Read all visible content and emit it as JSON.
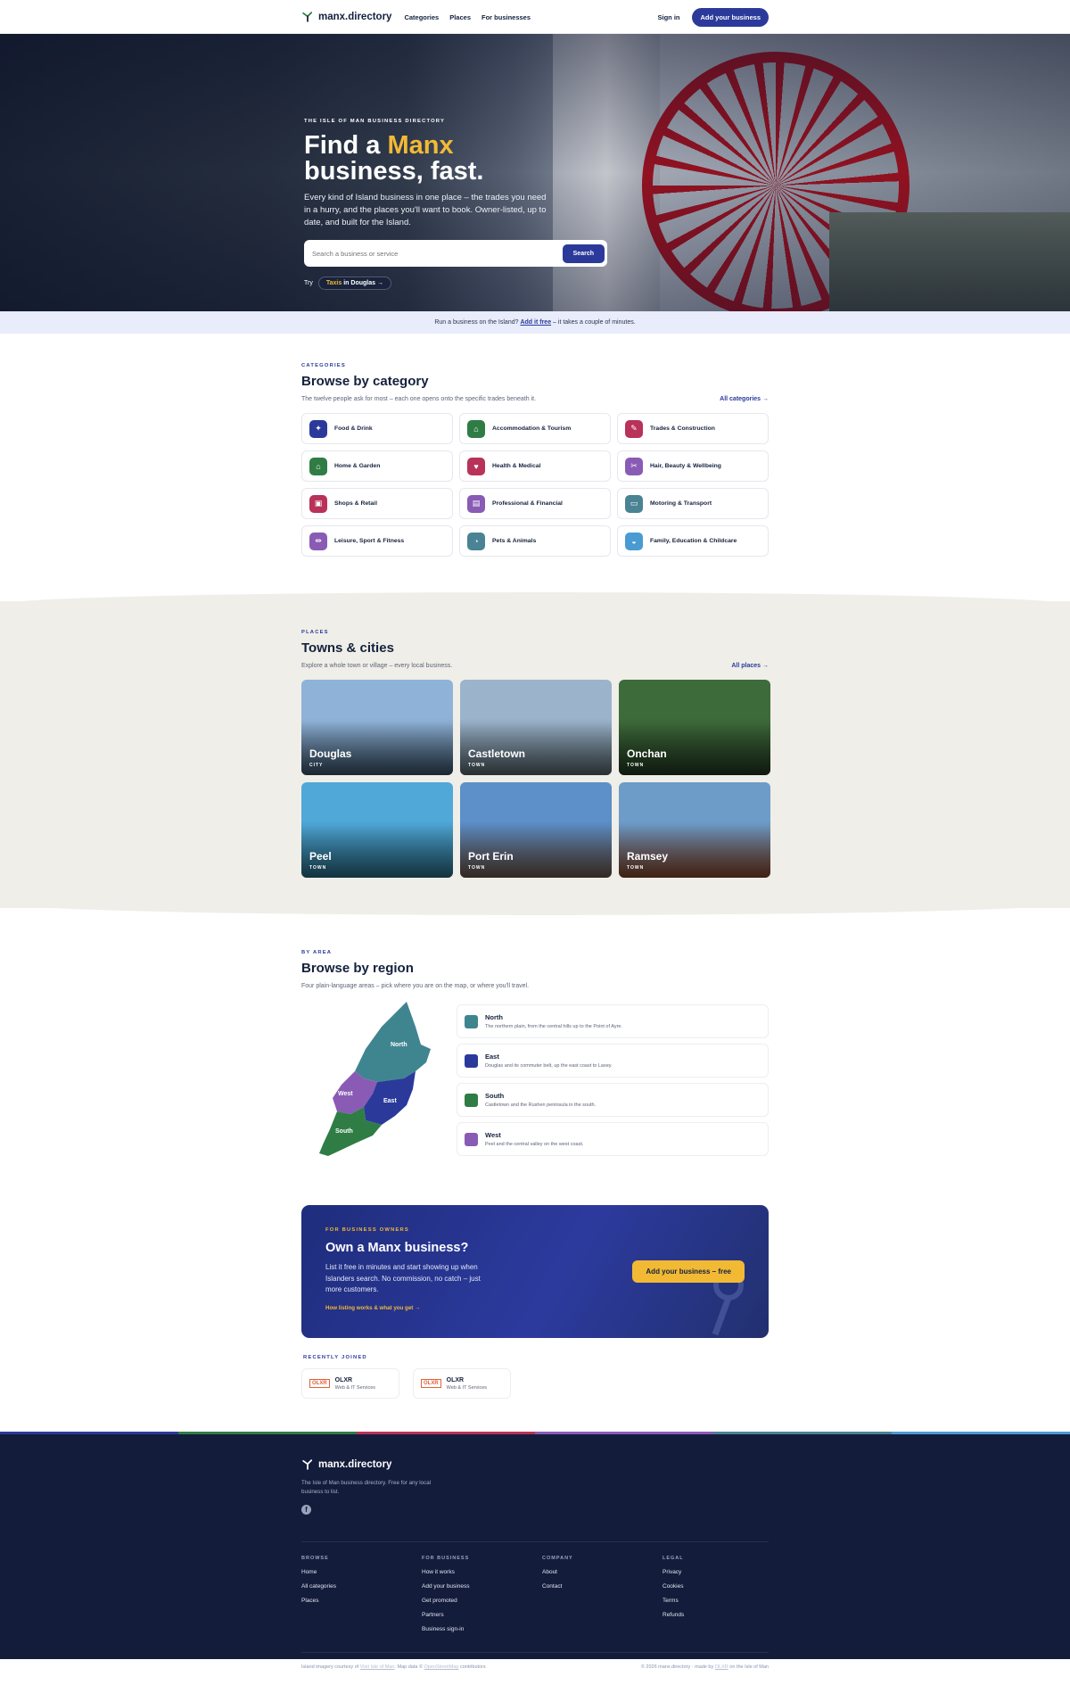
{
  "header": {
    "brand": "manx.directory",
    "nav": [
      "Categories",
      "Places",
      "For businesses"
    ],
    "sign_in": "Sign in",
    "add_business": "Add your business"
  },
  "hero": {
    "eyebrow": "THE ISLE OF MAN BUSINESS DIRECTORY",
    "title_1": "Find a ",
    "title_accent": "Manx",
    "title_2": "business, fast.",
    "lede": "Every kind of Island business in one place – the trades you need in a hurry, and the places you'll want to book. Owner-listed, up to date, and built for the Island.",
    "search_placeholder": "Search a business or service",
    "search_button": "Search",
    "try_label": "Try",
    "try_term": "Taxis",
    "try_in": "in",
    "try_place": "Douglas",
    "try_arrow": "→"
  },
  "banner": {
    "text_before": "Run a business on the Island?",
    "link": "Add it free",
    "text_after": "– it takes a couple of minutes."
  },
  "categories": {
    "eyebrow": "CATEGORIES",
    "title": "Browse by category",
    "subtitle": "The twelve people ask for most – each one opens onto the specific trades beneath it.",
    "link": "All categories →",
    "items": [
      {
        "label": "Food & Drink",
        "color": "#2b3a9a",
        "glyph": "✦"
      },
      {
        "label": "Accommodation & Tourism",
        "color": "#2f7d45",
        "glyph": "⌂"
      },
      {
        "label": "Trades & Construction",
        "color": "#b83259",
        "glyph": "✎"
      },
      {
        "label": "Home & Garden",
        "color": "#2f7d45",
        "glyph": "⌂"
      },
      {
        "label": "Health & Medical",
        "color": "#b83259",
        "glyph": "♥"
      },
      {
        "label": "Hair, Beauty & Wellbeing",
        "color": "#8a5bb5",
        "glyph": "✂"
      },
      {
        "label": "Shops & Retail",
        "color": "#b83259",
        "glyph": "▣"
      },
      {
        "label": "Professional & Financial",
        "color": "#8a5bb5",
        "glyph": "▤"
      },
      {
        "label": "Motoring & Transport",
        "color": "#4a8393",
        "glyph": "▭"
      },
      {
        "label": "Leisure, Sport & Fitness",
        "color": "#8a5bb5",
        "glyph": "⇹"
      },
      {
        "label": "Pets & Animals",
        "color": "#4a8393",
        "glyph": "◔"
      },
      {
        "label": "Family, Education & Childcare",
        "color": "#4a9bd1",
        "glyph": "◒"
      }
    ]
  },
  "places": {
    "eyebrow": "PLACES",
    "title": "Towns & cities",
    "subtitle": "Explore a whole town or village – every local business.",
    "link": "All places →",
    "items": [
      {
        "name": "Douglas",
        "type": "CITY",
        "c1": "#8fb3d8",
        "c2": "#3d566e"
      },
      {
        "name": "Castletown",
        "type": "TOWN",
        "c1": "#9bb4cc",
        "c2": "#5a6a72"
      },
      {
        "name": "Onchan",
        "type": "TOWN",
        "c1": "#3e6b3a",
        "c2": "#233b22"
      },
      {
        "name": "Peel",
        "type": "TOWN",
        "c1": "#4fa8d8",
        "c2": "#2b6f8a"
      },
      {
        "name": "Port Erin",
        "type": "TOWN",
        "c1": "#5d8fc8",
        "c2": "#6f5a4f"
      },
      {
        "name": "Ramsey",
        "type": "TOWN",
        "c1": "#6e9cc9",
        "c2": "#8a4a2e"
      }
    ]
  },
  "region": {
    "eyebrow": "BY AREA",
    "title": "Browse by region",
    "subtitle": "Four plain-language areas – pick where you are on the map, or where you'll travel.",
    "map_labels": {
      "north": "North",
      "west": "West",
      "east": "East",
      "south": "South"
    },
    "items": [
      {
        "name": "North",
        "desc": "The northern plain, from the central hills up to the Point of Ayre.",
        "color": "#3f8590"
      },
      {
        "name": "East",
        "desc": "Douglas and its commuter belt, up the east coast to Laxey.",
        "color": "#2b3a9a"
      },
      {
        "name": "South",
        "desc": "Castletown and the Rushen peninsula in the south.",
        "color": "#2f7d45"
      },
      {
        "name": "West",
        "desc": "Peel and the central valley on the west coast.",
        "color": "#8a5bb5"
      }
    ]
  },
  "cta": {
    "eyebrow": "FOR BUSINESS OWNERS",
    "title": "Own a Manx business?",
    "body": "List it free in minutes and start showing up when Islanders search. No commission, no catch – just more customers.",
    "link": "How listing works & what you get →",
    "button": "Add your business – free"
  },
  "recent": {
    "eyebrow": "RECENTLY JOINED",
    "items": [
      {
        "name": "OLXR",
        "category": "Web & IT Services",
        "logo": "OLXR"
      },
      {
        "name": "OLXR",
        "category": "Web & IT Services",
        "logo": "OLXR"
      }
    ]
  },
  "stripe_colors": [
    "#2b3a9a",
    "#2f7d45",
    "#b83259",
    "#8a5bb5",
    "#4a8393",
    "#4a9bd1"
  ],
  "footer": {
    "brand": "manx.directory",
    "tagline": "The Isle of Man business directory. Free for any local business to list.",
    "social_icon": "facebook-icon",
    "columns": [
      {
        "heading": "BROWSE",
        "links": [
          "Home",
          "All categories",
          "Places"
        ]
      },
      {
        "heading": "FOR BUSINESS",
        "links": [
          "How it works",
          "Add your business",
          "Get promoted",
          "Partners",
          "Business sign-in"
        ]
      },
      {
        "heading": "COMPANY",
        "links": [
          "About",
          "Contact"
        ]
      },
      {
        "heading": "LEGAL",
        "links": [
          "Privacy",
          "Cookies",
          "Terms",
          "Refunds"
        ]
      }
    ],
    "credit_1": "Island imagery courtesy of",
    "credit_link_1": "Visit Isle of Man",
    "credit_2": ". Map data ©",
    "credit_link_2": "OpenStreetMap",
    "credit_3": "contributors",
    "copyright": "© 2026 manx.directory · made by",
    "copyright_link": "OLXR",
    "copyright_end": "on the Isle of Man"
  }
}
